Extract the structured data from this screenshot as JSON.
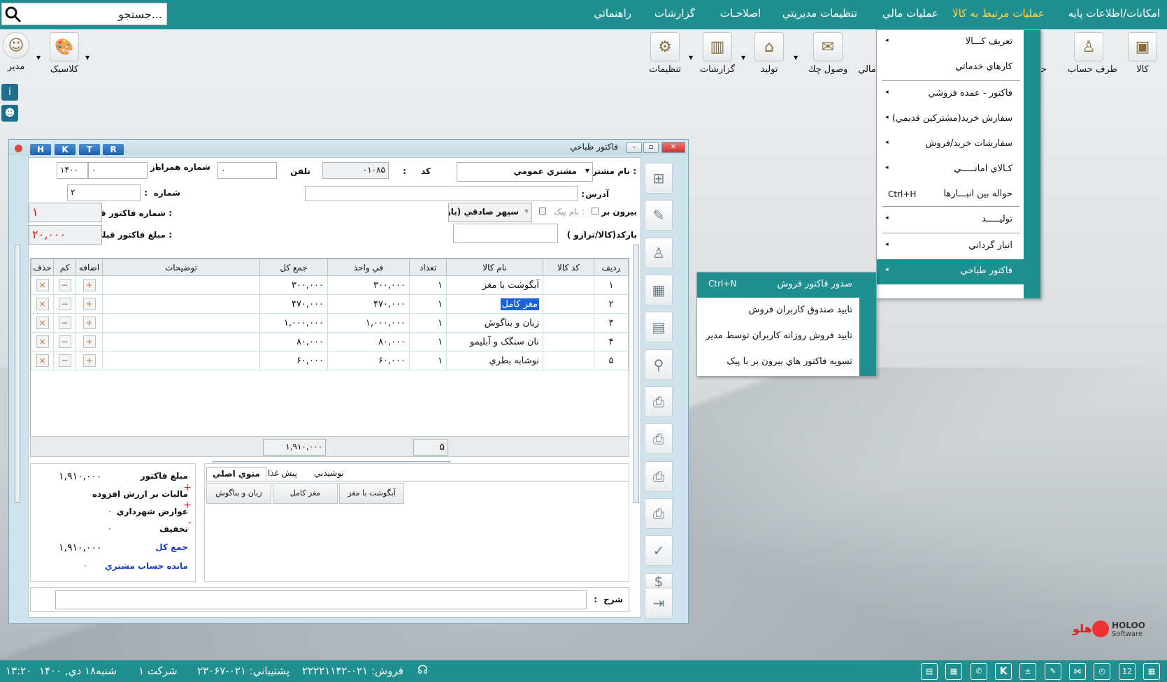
{
  "topbar": {
    "search_placeholder": "جستجو...",
    "menus": [
      "امکانات/اطلاعات پايه",
      "عمليات مرتبط به کالا",
      "عمليات مالي",
      "تنظيمات مديريتي",
      "اصلاحـات",
      "گزارشات",
      "راهنمائي"
    ]
  },
  "ribbon": {
    "items": [
      "کالا",
      "طرف حساب",
      "حسا",
      "مالي",
      "وصول چك",
      "توليد",
      "گزارشات",
      "تنظيمات",
      "كلاسيک",
      "مدير"
    ]
  },
  "window": {
    "title": "فاكتور طباخي",
    "hotkeys": [
      "H",
      "K",
      "T",
      "R"
    ]
  },
  "form": {
    "customer_label": "نام مشتري :",
    "customer_value": "مشتري عمومي",
    "code_label": "کد",
    "code_sep": ":",
    "code_value": "۰۱۰۸۵",
    "phone_label": "تلفن",
    "phone_value": "۰",
    "mobile_label": "شماره همراه",
    "mobile_value": "۰",
    "year_value": "۱۴۰۰",
    "az_label": "از",
    "address_label": "آدرس",
    "number_label": "شماره",
    "number_value": "۲",
    "prev_invoice_label": "شماره فاکتور قبلي :",
    "prev_invoice_value": "۱",
    "prev_amount_label": "مبلغ فاکتور قبلي :",
    "prev_amount_value": "۲۰,۰۰۰",
    "outside_label": "بيرون بر",
    "courier_label": "نام پيک :",
    "courier_value": "سپهر صادقي (بازاريابي)",
    "barcode_label": "بارکد(کالا/ترازو )",
    "sharh_label": "شرح"
  },
  "grid": {
    "headers": [
      "رديف",
      "کد کالا",
      "نام کالا",
      "تعداد",
      "في واحد",
      "جمع کل",
      "توضيحات",
      "اضافه",
      "کم",
      "حذف"
    ],
    "rows": [
      [
        "۱",
        "",
        "آبگوشت با مغز",
        "۱",
        "۳۰۰,۰۰۰",
        "۳۰۰,۰۰۰"
      ],
      [
        "۲",
        "",
        "مغز کامل",
        "۱",
        "۴۷۰,۰۰۰",
        "۴۷۰,۰۰۰"
      ],
      [
        "۳",
        "",
        "زبان و بناگوش",
        "۱",
        "۱,۰۰۰,۰۰۰",
        "۱,۰۰۰,۰۰۰"
      ],
      [
        "۴",
        "",
        "نان سنگک و آبليمو",
        "۱",
        "۸۰,۰۰۰",
        "۸۰,۰۰۰"
      ],
      [
        "۵",
        "",
        "نوشابه بطري",
        "۱",
        "۶۰,۰۰۰",
        "۶۰,۰۰۰"
      ]
    ],
    "total_count": "۵",
    "total_sum": "۱,۹۱۰,۰۰۰"
  },
  "summary": {
    "invoice_amount_label": "مبلغ فاکتور",
    "invoice_amount": "۱,۹۱۰,۰۰۰",
    "vat_label": "ماليات بر ارزش افزوده",
    "vat": "۰",
    "municipal_label": "عوارض شهرداري",
    "municipal": "۰",
    "discount_label": "تخفيف",
    "discount": "۰",
    "total_label": "جمع کل",
    "total": "۱,۹۱۰,۰۰۰",
    "balance_label": "مانده حساب مشتري",
    "balance": "۰"
  },
  "tabs": {
    "labels": [
      "منوي اصلي",
      "پيش غذا",
      "نوشيدني"
    ],
    "buttons": [
      "آبگوشت با مغز",
      "مغز کامل",
      "زبان و بناگوش"
    ]
  },
  "dropdown": {
    "items": [
      {
        "label": "تعريف کـــالا",
        "arrow": true
      },
      {
        "label": "کارهاي خدماتي",
        "arrow": false
      },
      {
        "label": "فاکتور - عمده فروشي",
        "arrow": true
      },
      {
        "label": "سفارش خريد(مشترکين قديمي)",
        "arrow": true
      },
      {
        "label": "سفارشات خريد/فروش",
        "arrow": true
      },
      {
        "label": "کـالاي امانـــــي",
        "arrow": true
      },
      {
        "label": "حواله بين انبـــارها",
        "shortcut": "Ctrl+H"
      },
      {
        "label": "توليـــــد",
        "arrow": true
      },
      {
        "label": "انبار گرداني",
        "arrow": true
      },
      {
        "label": "فاکتور طباخي",
        "arrow": true
      }
    ]
  },
  "submenu": {
    "items": [
      {
        "label": "صدور فاکتور فروش",
        "shortcut": "Ctrl+N"
      },
      {
        "label": "تاييد صندوق کاربران فروش"
      },
      {
        "label": "تاييد فروش روزانه کاربران توسط مدير"
      },
      {
        "label": "تسويه فاکتور هاي بيرون بر با پيک"
      }
    ]
  },
  "status": {
    "time": "۱۳:۲۰",
    "date": "شنبه۱۸ دي, ۱۴۰۰",
    "company": "شرکت ۱",
    "support": "پشتيباني: ۰۲۱-۲۳۰۶۷",
    "sales": "فروش: ۰۲۱-۲۲۲۲۱۱۴۲",
    "calendar_day": "12"
  },
  "logo": {
    "text": "هلو",
    "brand": "HOLOO",
    "sub": "Software"
  }
}
